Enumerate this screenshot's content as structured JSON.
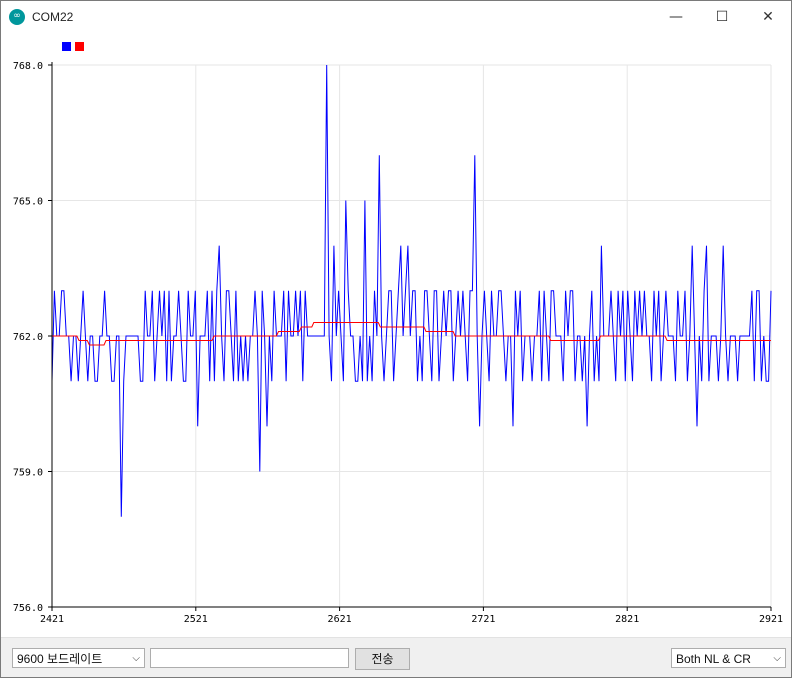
{
  "window": {
    "title": "COM22",
    "icon": "arduino-icon",
    "icon_glyph": "∞",
    "minimize_glyph": "—",
    "maximize_glyph": "☐",
    "close_glyph": "✕"
  },
  "legend": {
    "series_colors": [
      "#0000ff",
      "#ff0000"
    ]
  },
  "chart_data": {
    "type": "line",
    "x_ticks": [
      "2421",
      "2521",
      "2621",
      "2721",
      "2821",
      "2921"
    ],
    "y_ticks": [
      "756.0",
      "759.0",
      "762.0",
      "765.0",
      "768.0"
    ],
    "xlim": [
      2421,
      2921
    ],
    "ylim": [
      756,
      768
    ],
    "grid": true,
    "legend_position": "top-left",
    "series": [
      {
        "color": "#0000ff",
        "step": false,
        "values": [
          761,
          763,
          762,
          762,
          763,
          763,
          762,
          762,
          761,
          762,
          762,
          761,
          762,
          763,
          762,
          761,
          762,
          762,
          761,
          761,
          762,
          762,
          763,
          762,
          762,
          761,
          761,
          762,
          762,
          758,
          761,
          762,
          762,
          762,
          762,
          762,
          762,
          761,
          761,
          763,
          762,
          762,
          763,
          761,
          762,
          763,
          762,
          763,
          761,
          763,
          761,
          762,
          762,
          763,
          762,
          761,
          761,
          763,
          762,
          762,
          763,
          760,
          762,
          762,
          762,
          763,
          761,
          763,
          761,
          763,
          764,
          762,
          761,
          763,
          763,
          762,
          761,
          763,
          761,
          762,
          761,
          762,
          761,
          762,
          762,
          763,
          762,
          759,
          763,
          762,
          760,
          762,
          761,
          763,
          762,
          762,
          762,
          763,
          761,
          763,
          762,
          762,
          763,
          762,
          763,
          761,
          763,
          762,
          762,
          762,
          762,
          762,
          762,
          762,
          762,
          768,
          762,
          761,
          764,
          762,
          763,
          762,
          761,
          765,
          763,
          762,
          762,
          761,
          761,
          762,
          761,
          765,
          761,
          762,
          761,
          763,
          762,
          766,
          762,
          761,
          762,
          763,
          763,
          761,
          762,
          763,
          764,
          762,
          763,
          764,
          762,
          763,
          763,
          761,
          762,
          761,
          763,
          763,
          762,
          761,
          763,
          763,
          761,
          762,
          763,
          762,
          763,
          763,
          761,
          762,
          763,
          762,
          763,
          762,
          761,
          763,
          763,
          766,
          762,
          760,
          762,
          763,
          762,
          761,
          763,
          762,
          762,
          763,
          763,
          762,
          761,
          762,
          762,
          760,
          763,
          762,
          763,
          761,
          762,
          762,
          762,
          761,
          762,
          762,
          763,
          761,
          763,
          762,
          761,
          763,
          763,
          762,
          762,
          762,
          761,
          763,
          762,
          763,
          763,
          761,
          762,
          762,
          761,
          762,
          760,
          762,
          763,
          761,
          762,
          761,
          764,
          762,
          762,
          762,
          763,
          762,
          761,
          763,
          762,
          763,
          761,
          763,
          762,
          761,
          763,
          762,
          763,
          762,
          763,
          762,
          762,
          761,
          763,
          762,
          763,
          761,
          762,
          763,
          762,
          762,
          762,
          761,
          763,
          762,
          762,
          763,
          761,
          762,
          764,
          762,
          760,
          762,
          761,
          763,
          764,
          761,
          762,
          762,
          762,
          761,
          762,
          764,
          762,
          761,
          762,
          762,
          762,
          761,
          762,
          762,
          762,
          762,
          762,
          763,
          761,
          763,
          763,
          761,
          762,
          761,
          761,
          763
        ],
        "y_range": [
          758,
          768
        ]
      },
      {
        "color": "#ff0000",
        "step": false,
        "values": [
          762,
          762,
          762,
          762,
          762,
          762,
          762,
          762,
          762,
          762,
          762,
          762,
          762,
          761.9,
          761.9,
          761.9,
          761.9,
          761.9,
          761.8,
          761.8,
          761.8,
          761.8,
          761.8,
          761.8,
          761.8,
          761.8,
          761.9,
          761.9,
          761.9,
          761.9,
          761.9,
          761.9,
          761.9,
          761.9,
          761.9,
          761.9,
          761.9,
          761.9,
          761.9,
          761.9,
          761.9,
          761.9,
          761.9,
          761.9,
          761.9,
          761.9,
          761.9,
          761.9,
          761.9,
          761.9,
          761.9,
          761.9,
          761.9,
          761.9,
          761.9,
          761.9,
          761.9,
          761.9,
          761.9,
          761.9,
          761.9,
          761.9,
          761.9,
          761.9,
          761.9,
          761.9,
          761.9,
          761.9,
          761.9,
          761.9,
          761.9,
          761.9,
          761.9,
          761.9,
          761.9,
          761.9,
          761.9,
          761.9,
          762,
          762,
          762,
          762,
          762,
          762,
          762,
          762,
          762,
          762,
          762,
          762,
          762,
          762,
          762,
          762,
          762,
          762,
          762,
          762,
          762,
          762,
          762,
          762,
          762,
          762,
          762,
          762,
          762,
          762,
          762,
          762.1,
          762.1,
          762.1,
          762.1,
          762.1,
          762.1,
          762.1,
          762.1,
          762.1,
          762.1,
          762.1,
          762.2,
          762.2,
          762.2,
          762.2,
          762.2,
          762.2,
          762.3,
          762.3,
          762.3,
          762.3,
          762.3,
          762.3,
          762.3,
          762.3,
          762.3,
          762.3,
          762.3,
          762.3,
          762.3,
          762.3,
          762.3,
          762.3,
          762.3,
          762.3,
          762.3,
          762.3,
          762.3,
          762.3,
          762.3,
          762.3,
          762.3,
          762.3,
          762.3,
          762.3,
          762.3,
          762.3,
          762.3,
          762.3,
          762.2,
          762.2,
          762.2,
          762.2,
          762.2,
          762.2,
          762.2,
          762.2,
          762.2,
          762.2,
          762.2,
          762.2,
          762.2,
          762.2,
          762.2,
          762.2,
          762.2,
          762.2,
          762.2,
          762.2,
          762.2,
          762.2,
          762.1,
          762.1,
          762.1,
          762.1,
          762.1,
          762.1,
          762.1,
          762.1,
          762.1,
          762.1,
          762.1,
          762.1,
          762.1,
          762.1,
          762,
          762,
          762,
          762,
          762,
          762,
          762,
          762,
          762,
          762,
          762,
          762,
          762,
          762,
          762,
          762,
          762,
          762,
          762,
          762,
          762,
          762,
          762,
          762,
          762,
          762,
          762,
          762,
          762,
          762,
          762,
          762,
          762,
          762,
          762,
          762,
          762,
          762,
          762,
          762,
          762,
          762,
          762,
          762,
          762,
          762,
          761.9,
          761.9,
          761.9,
          761.9,
          761.9,
          761.9,
          761.9,
          761.9,
          761.9,
          761.9,
          761.9,
          761.9,
          761.9,
          761.9,
          761.9,
          761.9,
          761.9,
          761.9,
          761.9,
          761.9,
          761.9,
          761.9,
          761.9,
          761.9,
          762,
          762,
          762,
          762,
          762,
          762,
          762,
          762,
          762,
          762,
          762,
          762,
          762,
          762,
          762,
          762,
          762,
          762,
          762,
          762,
          762,
          762,
          762,
          762,
          762,
          762,
          762,
          762,
          762,
          762,
          762,
          762,
          761.9,
          761.9,
          761.9,
          761.9,
          761.9,
          761.9,
          761.9,
          761.9,
          761.9,
          761.9,
          761.9,
          761.9,
          761.9,
          761.9,
          761.9,
          761.9,
          761.9,
          761.9,
          761.9,
          761.9,
          761.9,
          761.9,
          761.9,
          761.9,
          761.9,
          761.9,
          761.9,
          761.9,
          761.9,
          761.9,
          761.9,
          761.9,
          761.9,
          761.9,
          761.9,
          761.9,
          761.9,
          761.9,
          761.9,
          761.9,
          761.9,
          761.9,
          761.9,
          761.9,
          761.9,
          761.9,
          761.9,
          761.9,
          761.9,
          761.9,
          761.9
        ]
      }
    ]
  },
  "bottom_bar": {
    "baud_rate": "9600 보드레이트",
    "message_input_value": "",
    "send_label": "전송",
    "line_ending": "Both NL & CR",
    "dropdown_glyph": "⌵"
  }
}
